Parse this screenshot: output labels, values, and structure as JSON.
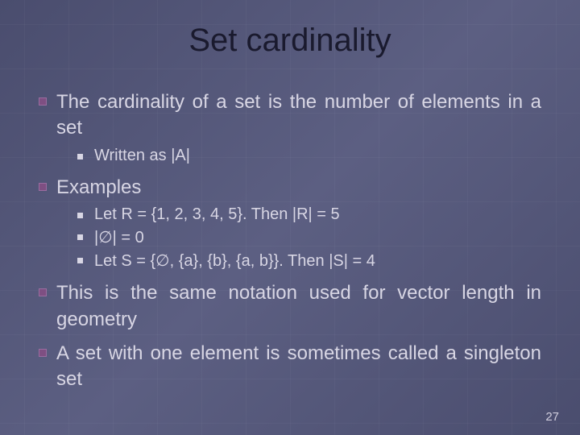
{
  "title": "Set cardinality",
  "bullets": {
    "b1": "The cardinality of a set is the number of elements in a set",
    "b1_sub": {
      "s1": "Written as |A|"
    },
    "b2": "Examples",
    "b2_sub": {
      "s1": "Let R = {1, 2, 3, 4, 5}.  Then |R| = 5",
      "s2": "|∅| = 0",
      "s3": "Let S = {∅, {a}, {b}, {a, b}}.  Then |S| = 4"
    },
    "b3": "This is the same notation used for vector length in geometry",
    "b4": "A set with one element is sometimes called a singleton set"
  },
  "page_number": "27"
}
